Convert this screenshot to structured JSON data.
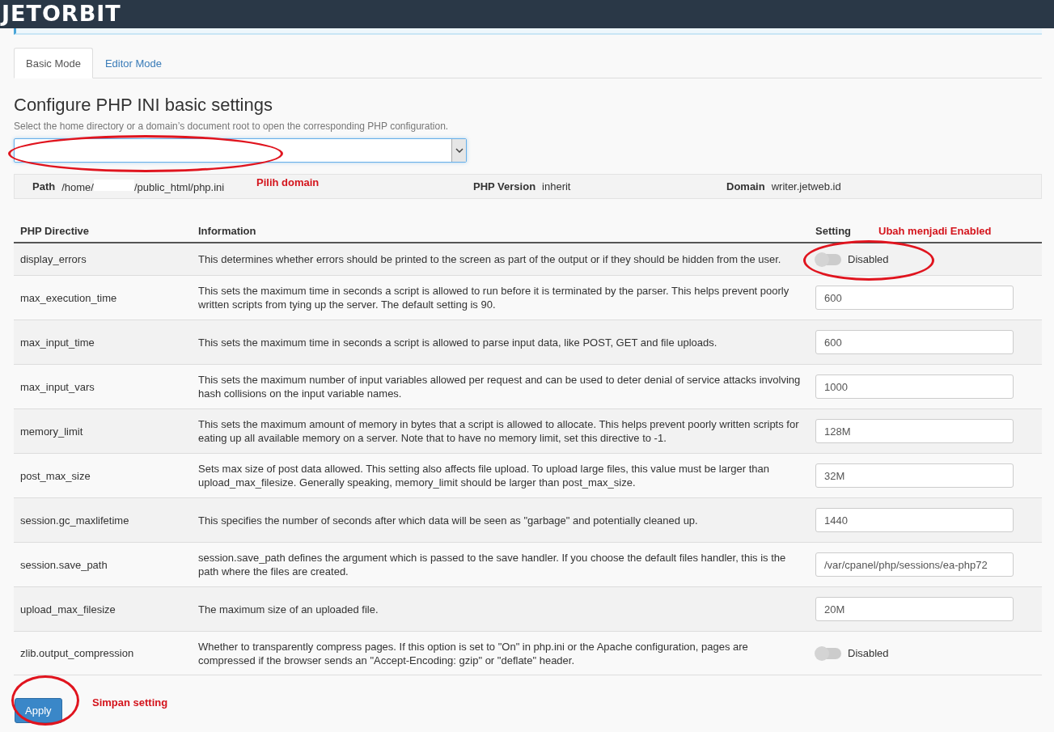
{
  "header": {
    "logo": "JETORBIT"
  },
  "tabs": [
    {
      "label": "Basic Mode",
      "selected": true
    },
    {
      "label": "Editor Mode",
      "selected": false
    }
  ],
  "title": "Configure PHP INI basic settings",
  "subtitle": "Select the home directory or a domain’s document root to open the corresponding PHP configuration.",
  "info_bar": {
    "path_label": "Path",
    "path_start": "/home/",
    "path_end": "/public_html/php.ini",
    "version_label": "PHP Version",
    "version": "inherit",
    "domain_label": "Domain",
    "domain": "writer.jetweb.id"
  },
  "table": {
    "columns": [
      "PHP Directive",
      "Information",
      "Setting"
    ],
    "rows": [
      {
        "directive": "display_errors",
        "information": "This determines whether errors should be printed to the screen as part of the output or if they should be hidden from the user.",
        "kind": "toggle",
        "on": false,
        "label": "Disabled"
      },
      {
        "directive": "max_execution_time",
        "information": "This sets the maximum time in seconds a script is allowed to run before it is terminated by the parser. This helps prevent poorly written scripts from tying up the server. The default setting is 90.",
        "kind": "text",
        "value": "600"
      },
      {
        "directive": "max_input_time",
        "information": "This sets the maximum time in seconds a script is allowed to parse input data, like POST, GET and file uploads.",
        "kind": "text",
        "value": "600"
      },
      {
        "directive": "max_input_vars",
        "information": "This sets the maximum number of input variables allowed per request and can be used to deter denial of service attacks involving hash collisions on the input variable names.",
        "kind": "text",
        "value": "1000"
      },
      {
        "directive": "memory_limit",
        "information": "This sets the maximum amount of memory in bytes that a script is allowed to allocate. This helps prevent poorly written scripts for eating up all available memory on a server. Note that to have no memory limit, set this directive to -1.",
        "kind": "text",
        "value": "128M"
      },
      {
        "directive": "post_max_size",
        "information": "Sets max size of post data allowed. This setting also affects file upload. To upload large files, this value must be larger than upload_max_filesize. Generally speaking, memory_limit should be larger than post_max_size.",
        "kind": "text",
        "value": "32M"
      },
      {
        "directive": "session.gc_maxlifetime",
        "information": "This specifies the number of seconds after which data will be seen as \"garbage\" and potentially cleaned up.",
        "kind": "text",
        "value": "1440"
      },
      {
        "directive": "session.save_path",
        "information": "session.save_path defines the argument which is passed to the save handler. If you choose the default files handler, this is the path where the files are created.",
        "kind": "text",
        "value": "/var/cpanel/php/sessions/ea-php72"
      },
      {
        "directive": "upload_max_filesize",
        "information": "The maximum size of an uploaded file.",
        "kind": "text",
        "value": "20M"
      },
      {
        "directive": "zlib.output_compression",
        "information": "Whether to transparently compress pages. If this option is set to \"On\" in php.ini or the Apache configuration, pages are compressed if the browser sends an \"Accept-Encoding: gzip\" or \"deflate\" header.",
        "kind": "toggle",
        "on": false,
        "label": "Disabled"
      }
    ]
  },
  "apply_button": "Apply",
  "annotations": [
    {
      "text": "Pilih domain"
    },
    {
      "text": "Ubah menjadi Enabled"
    },
    {
      "text": "Simpan setting"
    }
  ]
}
